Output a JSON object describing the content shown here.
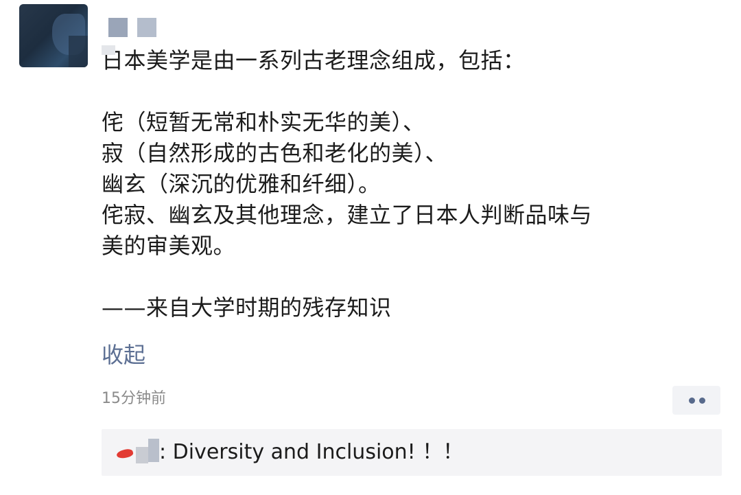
{
  "post": {
    "body": "日本美学是由一系列古老理念组成，包括：\n\n侘（短暂无常和朴实无华的美）、\n寂（自然形成的古色和老化的美）、\n幽玄（深沉的优雅和纤细）。\n侘寂、幽玄及其他理念，建立了日本人判断品味与\n美的审美观。\n\n——来自大学时期的残存知识",
    "collapse_label": "收起",
    "timestamp": "15分钟前"
  },
  "comment": {
    "text": ": Diversity and Inclusion! ！！"
  },
  "icons": {
    "more": "more-dots-icon"
  },
  "colors": {
    "link": "#5c6f93",
    "timestamp": "#8a8a8a",
    "comment_bg": "#f4f4f6"
  }
}
